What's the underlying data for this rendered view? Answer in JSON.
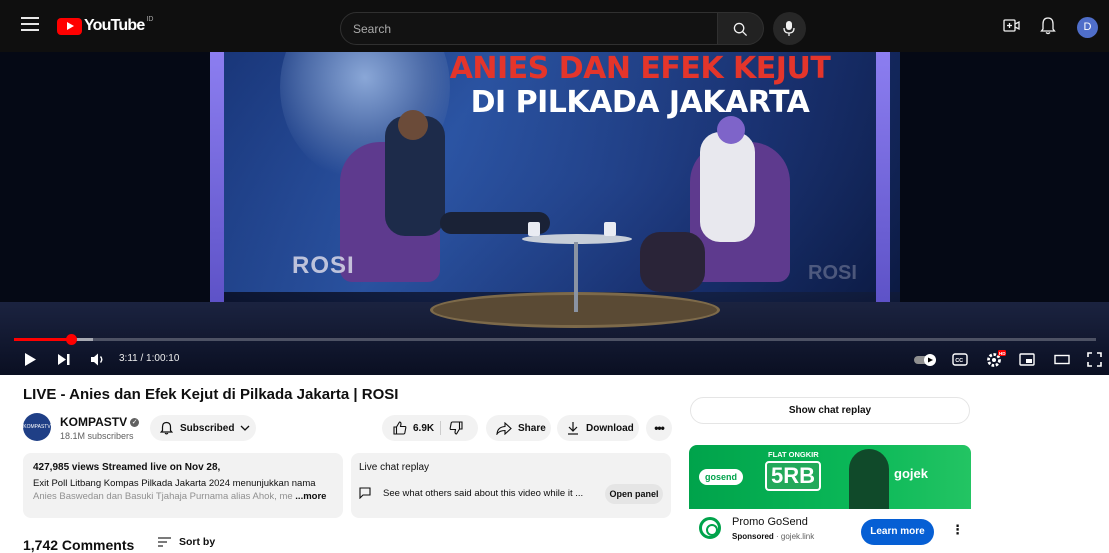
{
  "header": {
    "logo_text": "YouTube",
    "country_code": "ID",
    "search_placeholder": "Search",
    "avatar_letter": "D"
  },
  "video_frame": {
    "headline_line1": "ANIES DAN EFEK KEJUT",
    "headline_line2": "DI PILKADA JAKARTA",
    "watermark": "ROSI",
    "watermark_right": "ROSI"
  },
  "player": {
    "time_display": "3:11 / 1:00:10",
    "progress_fraction": 0.053,
    "hd_badge": "HD"
  },
  "video": {
    "title": "LIVE - Anies dan Efek Kejut di Pilkada Jakarta | ROSI",
    "channel_name": "KOMPASTV",
    "channel_avatar_text": "KOMPASTV",
    "subscribers": "18.1M subscribers",
    "subscribed_label": "Subscribed",
    "likes": "6.9K",
    "share_label": "Share",
    "download_label": "Download"
  },
  "description": {
    "stats": "427,985 views  Streamed live on Nov 28,",
    "line1": "Exit Poll Litbang Kompas Pilkada Jakarta 2024 menunjukkan nama",
    "line2": "Anies Baswedan dan Basuki Tjahaja Purnama alias Ahok, me",
    "more_label": "...more"
  },
  "live_chat": {
    "heading": "Live chat replay",
    "prompt": "See what others said about this video while it ...",
    "open_panel_label": "Open panel"
  },
  "comments": {
    "count_label": "1,742 Comments",
    "sort_label": "Sort by"
  },
  "sidebar": {
    "show_chat_label": "Show chat replay",
    "ad": {
      "banner_gosend": "gosend",
      "banner_flat": "FLAT ONGKIR",
      "banner_value": "5RB",
      "banner_brand": "gojek",
      "title": "Promo GoSend",
      "sponsored_label": "Sponsored",
      "domain": "gojek.link",
      "cta": "Learn more"
    }
  },
  "colors": {
    "brand_red": "#ff0000",
    "cta_blue": "#065fd4",
    "ad_green": "#00a34b"
  }
}
